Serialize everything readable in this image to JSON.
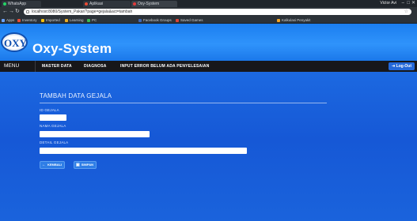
{
  "browser": {
    "tabs": [
      {
        "label": "WhatsApp"
      },
      {
        "label": "Aplikasi"
      },
      {
        "label": "Oxy-System"
      }
    ],
    "window_user": "Victor Avi",
    "address": "localhost:8080/System_Pakar/?page=gejala&act=tambah",
    "bookmarks": [
      {
        "label": "Apps",
        "color": "#6aa2ff"
      },
      {
        "label": "Inventory",
        "color": "#e94b35"
      },
      {
        "label": "Imported",
        "color": "#f4c20d"
      },
      {
        "label": "Learning",
        "color": "#e9ad26"
      },
      {
        "label": "PC",
        "color": "#3cba54"
      },
      {
        "label": "Facebook Groups",
        "color": "#4267b2"
      },
      {
        "label": "Saved Games",
        "color": "#db4437"
      },
      {
        "label": "Kalkulasi Penyakit",
        "color": "#f4a524"
      }
    ]
  },
  "header": {
    "logo_text": "OXY",
    "brand": "Oxy-System"
  },
  "menu": {
    "label": "MENU",
    "items": [
      {
        "label": "MASTER DATA"
      },
      {
        "label": "DIAGNOSA"
      },
      {
        "label": "INPUT ERROR BELUM ADA PENYELESAIAN"
      }
    ],
    "logout_label": "Log-Out"
  },
  "form": {
    "title": "TAMBAH DATA GEJALA",
    "fields": [
      {
        "label": "ID GEJALA",
        "value": ""
      },
      {
        "label": "NAMA GEJALA",
        "value": ""
      },
      {
        "label": "DETAIL GEJALA",
        "value": ""
      }
    ],
    "back_label": "KEMBALI",
    "save_label": "SIMPAN"
  },
  "colors": {
    "header": "#1b7ef0",
    "menubar": "#17171a",
    "content": "#1658d6",
    "button": "#2f7ee6"
  }
}
